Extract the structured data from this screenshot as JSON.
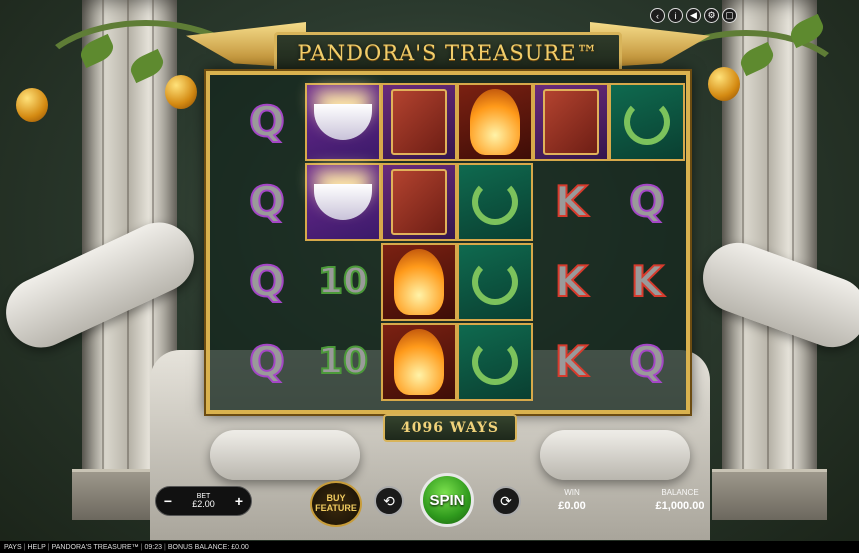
{
  "game": {
    "title": "PANDORA'S TREASURE™",
    "ways_label": "4096 WAYS"
  },
  "controls": [
    {
      "icon": "back-arrow-icon",
      "glyph": "‹"
    },
    {
      "icon": "info-icon",
      "glyph": "i"
    },
    {
      "icon": "sound-icon",
      "glyph": "◀"
    },
    {
      "icon": "settings-icon",
      "glyph": "⚙"
    },
    {
      "icon": "fullscreen-icon",
      "glyph": "▢"
    }
  ],
  "reels": [
    [
      "Q",
      "hands",
      "book",
      "torch",
      "book",
      "laurel"
    ],
    [
      "Q",
      "hands",
      "book",
      "laurel",
      "K",
      "Q"
    ],
    [
      "Q",
      "10",
      "torch",
      "laurel",
      "K",
      "K"
    ],
    [
      "Q",
      "10",
      "torch",
      "laurel",
      "K",
      "Q"
    ]
  ],
  "hud": {
    "bet_label": "BET",
    "bet_value": "£2.00",
    "buy_line1": "BUY",
    "buy_line2": "FEATURE",
    "spin_label": "SPIN",
    "win_label": "WIN",
    "win_value": "£0.00",
    "balance_label": "BALANCE",
    "balance_value": "£1,000.00"
  },
  "status_bar": {
    "pays": "PAYS",
    "help": "HELP",
    "game_name": "PANDORA'S TREASURE™",
    "time": "09:23",
    "bonus_balance": "BONUS BALANCE: £0.00"
  }
}
